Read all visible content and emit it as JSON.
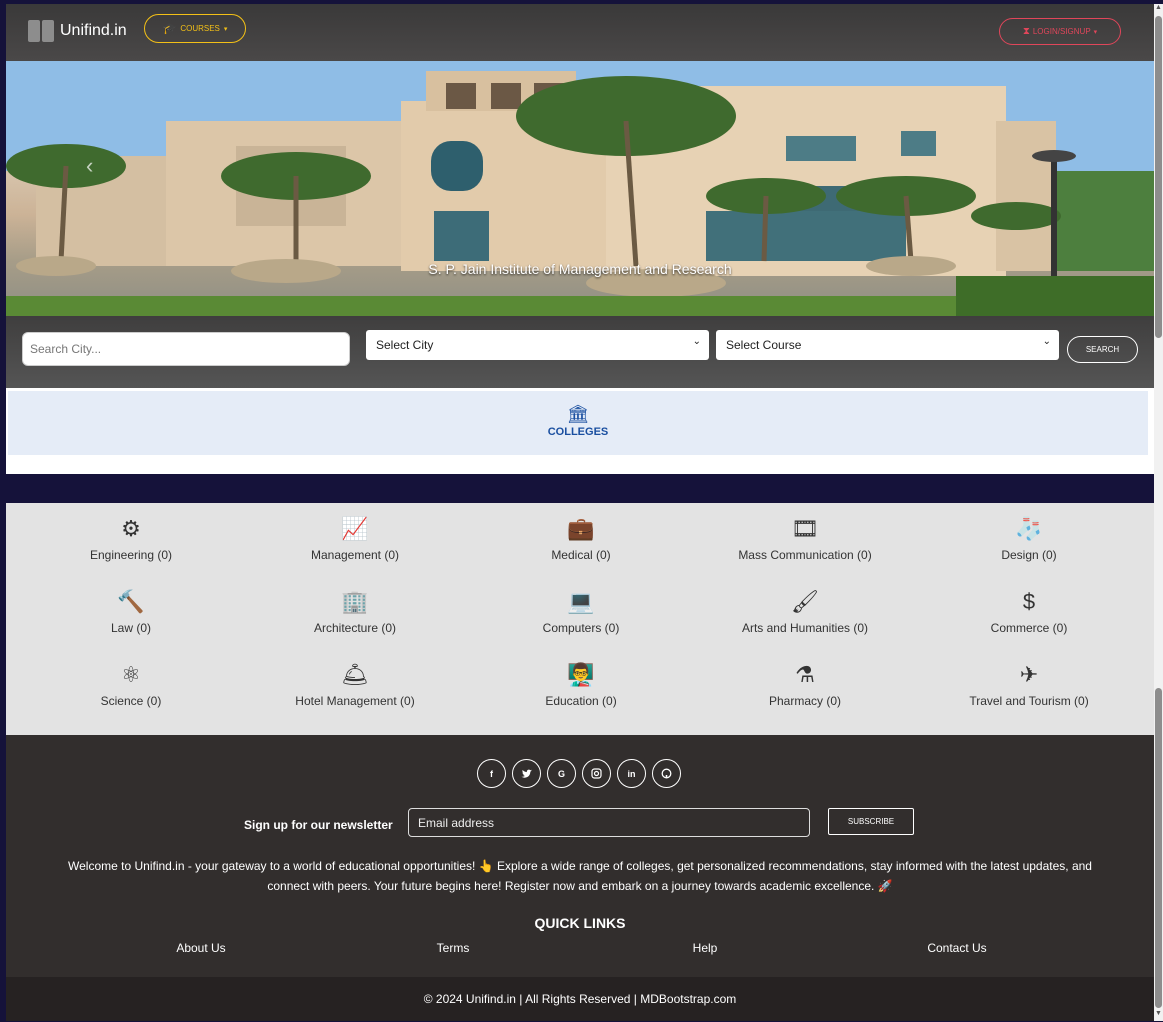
{
  "navbar": {
    "brand": "Unifind.in",
    "courses_label": "COURSES",
    "login_label": "LOGIN/SIGNUP"
  },
  "hero": {
    "caption": "S. P. Jain Institute of Management and Research"
  },
  "search": {
    "city_placeholder": "Search City...",
    "select_city": "Select City",
    "select_course": "Select Course",
    "search_label": "SEARCH"
  },
  "tab": {
    "colleges": "COLLEGES"
  },
  "categories": [
    {
      "name": "Engineering (0)",
      "icon": "gears-icon"
    },
    {
      "name": "Management (0)",
      "icon": "chart-line-icon"
    },
    {
      "name": "Medical (0)",
      "icon": "medical-kit-icon"
    },
    {
      "name": "Mass Communication (0)",
      "icon": "film-icon"
    },
    {
      "name": "Design (0)",
      "icon": "socks-icon"
    },
    {
      "name": "Law (0)",
      "icon": "gavel-icon"
    },
    {
      "name": "Architecture (0)",
      "icon": "building-icon"
    },
    {
      "name": "Computers (0)",
      "icon": "laptop-icon"
    },
    {
      "name": "Arts and Humanities (0)",
      "icon": "paintbrush-icon"
    },
    {
      "name": "Commerce (0)",
      "icon": "hand-dollar-icon"
    },
    {
      "name": "Science (0)",
      "icon": "atom-icon"
    },
    {
      "name": "Hotel Management (0)",
      "icon": "concierge-bell-icon"
    },
    {
      "name": "Education (0)",
      "icon": "chalkboard-teacher-icon"
    },
    {
      "name": "Pharmacy (0)",
      "icon": "flask-icon"
    },
    {
      "name": "Travel and Tourism (0)",
      "icon": "plane-departure-icon"
    }
  ],
  "footer": {
    "socials": [
      "f",
      "t",
      "G",
      "ig",
      "in",
      "gh"
    ],
    "newsletter_label": "Sign up for our newsletter",
    "email_placeholder": "Email address",
    "subscribe_label": "SUBSCRIBE",
    "about_text": "Welcome to Unifind.in - your gateway to a world of educational opportunities! 👆 Explore a wide range of colleges, get personalized recommendations, stay informed with the latest updates, and connect with peers. Your future begins here! Register now and embark on a journey towards academic excellence. 🚀",
    "quick_links_title": "QUICK LINKS",
    "links": [
      "About Us",
      "Terms",
      "Help",
      "Contact Us"
    ],
    "copyright": "© 2024 Unifind.in | All Rights Reserved | MDBootstrap.com"
  }
}
